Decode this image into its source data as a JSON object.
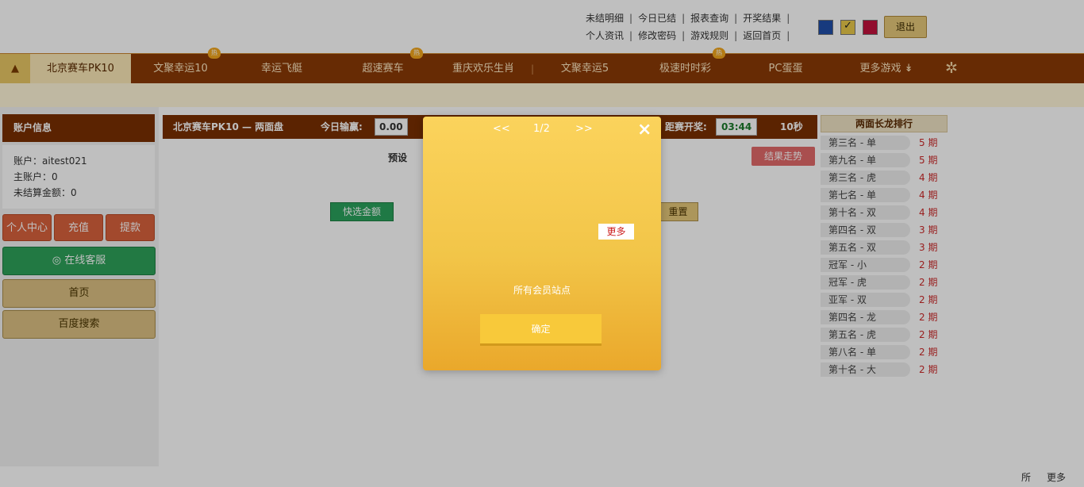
{
  "top_links": {
    "row1": [
      "未结明细",
      "今日已结",
      "报表查询",
      "开奖结果"
    ],
    "row2": [
      "个人资讯",
      "修改密码",
      "游戏规则",
      "返回首页"
    ],
    "logout": "退出"
  },
  "theme_colors": {
    "blue": "#1f4ea8",
    "yellow": "#e8c94a",
    "red": "#c2123c"
  },
  "nav": {
    "home_icon": "home-icon",
    "items": [
      {
        "label": "北京赛车PK10",
        "active": true
      },
      {
        "label": "文聚幸运10",
        "hot": true
      },
      {
        "label": "幸运飞艇"
      },
      {
        "label": "超速赛车",
        "hot": true
      },
      {
        "label": "重庆欢乐生肖"
      },
      {
        "label": "文聚幸运5"
      },
      {
        "label": "极速时时彩",
        "hot": true
      },
      {
        "label": "PC蛋蛋"
      },
      {
        "label": "更多游戏"
      }
    ],
    "hot_badge": "热"
  },
  "account": {
    "title": "账户信息",
    "account_label": "账户：",
    "account_value": "aitest021",
    "main_label": "主账户：",
    "main_value": "0",
    "unsettled_label": "未结算金额：",
    "unsettled_value": "0",
    "buttons": {
      "personal": "个人中心",
      "recharge": "充值",
      "withdraw": "提款"
    },
    "service": "在线客服",
    "home": "首页",
    "baidu": "百度搜索"
  },
  "main": {
    "title": "北京赛车PK10 — 两面盘",
    "profit_label": "今日输赢:",
    "profit_value": "0.00",
    "countdown_label": "距赛开奖:",
    "countdown_value": "03:44",
    "seconds": "10秒",
    "preset_label": "预设",
    "result_button": "结果走势",
    "quick_amount": "快选金额",
    "reset": "重置"
  },
  "ranking": {
    "title": "两面长龙排行",
    "items": [
      {
        "name": "第三名 - 单",
        "count": "5 期"
      },
      {
        "name": "第九名 - 单",
        "count": "5 期"
      },
      {
        "name": "第三名 - 虎",
        "count": "4 期"
      },
      {
        "name": "第七名 - 单",
        "count": "4 期"
      },
      {
        "name": "第十名 - 双",
        "count": "4 期"
      },
      {
        "name": "第四名 - 双",
        "count": "3 期"
      },
      {
        "name": "第五名 - 双",
        "count": "3 期"
      },
      {
        "name": "冠军 - 小",
        "count": "2 期"
      },
      {
        "name": "冠军 - 虎",
        "count": "2 期"
      },
      {
        "name": "亚军 - 双",
        "count": "2 期"
      },
      {
        "name": "第四名 - 龙",
        "count": "2 期"
      },
      {
        "name": "第五名 - 虎",
        "count": "2 期"
      },
      {
        "name": "第八名 - 单",
        "count": "2 期"
      },
      {
        "name": "第十名 - 大",
        "count": "2 期"
      }
    ]
  },
  "modal": {
    "prev": "<<",
    "page": "1/2",
    "next": ">>",
    "close": "×",
    "more": "更多",
    "body": "所有会员站点",
    "confirm": "确定"
  },
  "footer": {
    "item1": "所",
    "item2": "更多"
  }
}
